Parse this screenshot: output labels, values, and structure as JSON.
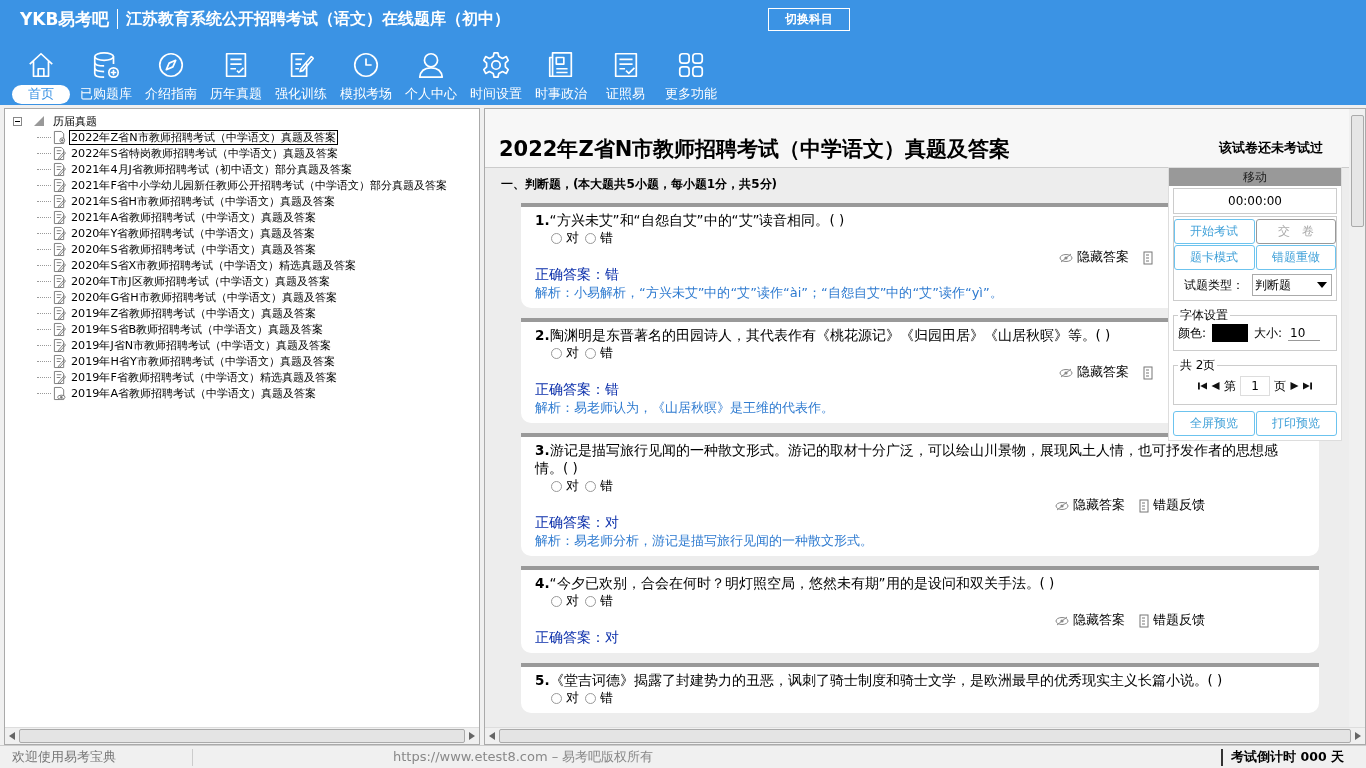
{
  "header": {
    "logo": "YKB易考吧",
    "title": "江苏教育系统公开招聘考试（语文）在线题库（初中）",
    "switch_button": "切换科目"
  },
  "toolbar": [
    {
      "label": "首页",
      "kind": "home",
      "selected": true
    },
    {
      "label": "已购题库",
      "kind": "database",
      "selected": false
    },
    {
      "label": "介绍指南",
      "kind": "compass",
      "selected": false
    },
    {
      "label": "历年真题",
      "kind": "list",
      "selected": false
    },
    {
      "label": "强化训练",
      "kind": "edit",
      "selected": false
    },
    {
      "label": "模拟考场",
      "kind": "clock",
      "selected": false
    },
    {
      "label": "个人中心",
      "kind": "user",
      "selected": false
    },
    {
      "label": "时间设置",
      "kind": "gear",
      "selected": false
    },
    {
      "label": "时事政治",
      "kind": "news",
      "selected": false
    },
    {
      "label": "证照易",
      "kind": "check",
      "selected": false
    },
    {
      "label": "更多功能",
      "kind": "grid",
      "selected": false
    }
  ],
  "tree": {
    "label": "历届真题",
    "expanded": true,
    "children": [
      {
        "label": "2022年Z省N市教师招聘考试（中学语文）真题及答案",
        "kind": "current",
        "selected": true
      },
      {
        "label": "2022年S省特岗教师招聘考试（中学语文）真题及答案",
        "kind": "edit",
        "selected": false
      },
      {
        "label": "2021年4月J省教师招聘考试（初中语文）部分真题及答案",
        "kind": "edit",
        "selected": false
      },
      {
        "label": "2021年F省中小学幼儿园新任教师公开招聘考试（中学语文）部分真题及答案",
        "kind": "edit",
        "selected": false
      },
      {
        "label": "2021年S省H市教师招聘考试（中学语文）真题及答案",
        "kind": "edit",
        "selected": false
      },
      {
        "label": "2021年A省教师招聘考试（中学语文）真题及答案",
        "kind": "edit",
        "selected": false
      },
      {
        "label": "2020年Y省教师招聘考试（中学语文）真题及答案",
        "kind": "edit",
        "selected": false
      },
      {
        "label": "2020年S省教师招聘考试（中学语文）真题及答案",
        "kind": "edit",
        "selected": false
      },
      {
        "label": "2020年S省X市教师招聘考试（中学语文）精选真题及答案",
        "kind": "edit",
        "selected": false
      },
      {
        "label": "2020年T市J区教师招聘考试（中学语文）真题及答案",
        "kind": "edit",
        "selected": false
      },
      {
        "label": "2020年G省H市教师招聘考试（中学语文）真题及答案",
        "kind": "edit",
        "selected": false
      },
      {
        "label": "2019年Z省教师招聘考试（中学语文）真题及答案",
        "kind": "edit",
        "selected": false
      },
      {
        "label": "2019年S省B教师招聘考试（中学语文）真题及答案",
        "kind": "edit",
        "selected": false
      },
      {
        "label": "2019年J省N市教师招聘考试（中学语文）真题及答案",
        "kind": "edit",
        "selected": false
      },
      {
        "label": "2019年H省Y市教师招聘考试（中学语文）真题及答案",
        "kind": "edit",
        "selected": false
      },
      {
        "label": "2019年F省教师招聘考试（中学语文）精选真题及答案",
        "kind": "edit",
        "selected": false
      },
      {
        "label": "2019年A省教师招聘考试（中学语文）真题及答案",
        "kind": "viewed",
        "selected": false
      }
    ]
  },
  "paper": {
    "title": "2022年Z省N市教师招聘考试（中学语文）真题及答案",
    "status": "该试卷还未考试过",
    "section": "一、判断题，(本大题共5小题，每小题1分，共5分)",
    "questions": [
      {
        "number": "1.",
        "text": "“方兴未艾”和“自怨自艾”中的“艾”读音相同。( )",
        "options": [
          {
            "label": "对",
            "selected": false
          },
          {
            "label": "错",
            "selected": false
          }
        ],
        "hide_answer": "隐藏答案",
        "answer_label": "正确答案：",
        "answer": "错",
        "analysis": "解析：小易解析，“方兴未艾”中的“艾”读作“ài”；“自怨自艾”中的“艾”读作“yì”。"
      },
      {
        "number": "2.",
        "text": "陶渊明是东晋著名的田园诗人，其代表作有《桃花源记》《归园田居》《山居秋暝》等。( )",
        "options": [
          {
            "label": "对",
            "selected": false
          },
          {
            "label": "错",
            "selected": false
          }
        ],
        "hide_answer": "隐藏答案",
        "answer_label": "正确答案：",
        "answer": "错",
        "analysis": "解析：易老师认为，《山居秋暝》是王维的代表作。"
      },
      {
        "number": "3.",
        "text": "游记是描写旅行见闻的一种散文形式。游记的取材十分广泛，可以绘山川景物，展现风土人情，也可抒发作者的思想感情。( )",
        "options": [
          {
            "label": "对",
            "selected": false
          },
          {
            "label": "错",
            "selected": false
          }
        ],
        "hide_answer": "隐藏答案",
        "feedback": "错题反馈",
        "answer_label": "正确答案：",
        "answer": "对",
        "analysis": "解析：易老师分析，游记是描写旅行见闻的一种散文形式。"
      },
      {
        "number": "4.",
        "text": "“今夕已欢别，合会在何时？明灯照空局，悠然未有期”用的是设问和双关手法。( )",
        "options": [
          {
            "label": "对",
            "selected": false
          },
          {
            "label": "错",
            "selected": false
          }
        ],
        "hide_answer": "隐藏答案",
        "feedback": "错题反馈",
        "answer_label": "正确答案：",
        "answer": "对"
      },
      {
        "number": "5.",
        "text": "《堂吉诃德》揭露了封建势力的丑恶，讽刺了骑士制度和骑士文学，是欧洲最早的优秀现实主义长篇小说。( )",
        "options": [
          {
            "label": "对",
            "selected": false
          },
          {
            "label": "错",
            "selected": false
          }
        ]
      }
    ]
  },
  "side_panel": {
    "header": "移动",
    "timer": "00:00:00",
    "buttons": [
      {
        "label": "开始考试",
        "disabled": false
      },
      {
        "label": "交　卷",
        "disabled": true
      },
      {
        "label": "题卡模式",
        "disabled": false
      },
      {
        "label": "错题重做",
        "disabled": false
      }
    ],
    "type_label": "试题类型：",
    "type_value": "判断题",
    "font_group": "字体设置",
    "color_label": "颜色:",
    "size_label": "大小:",
    "size_value": "10",
    "pages_group": "共 2页",
    "page_prefix": "第",
    "page_value": "1",
    "page_suffix": "页",
    "bottom_buttons": [
      {
        "label": "全屏预览",
        "disabled": false
      },
      {
        "label": "打印预览",
        "disabled": false
      }
    ]
  },
  "status_bar": {
    "welcome": "欢迎使用易考宝典",
    "copyright": "https://www.etest8.com – 易考吧版权所有",
    "countdown": "考试倒计时 000 天"
  }
}
